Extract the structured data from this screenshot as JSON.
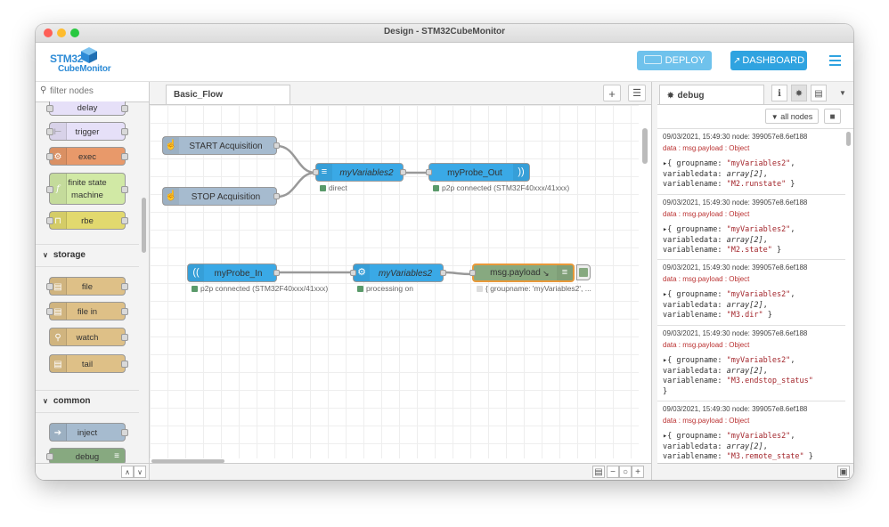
{
  "window": {
    "title": "Design - STM32CubeMonitor"
  },
  "header": {
    "logo_line1": "STM32",
    "logo_line2": "CubeMonitor",
    "deploy_label": "DEPLOY",
    "dashboard_label": "DASHBOARD"
  },
  "palette": {
    "filter_placeholder": "filter nodes",
    "nodes_top": [
      {
        "label": "delay"
      },
      {
        "label": "trigger"
      },
      {
        "label": "exec"
      },
      {
        "label_line1": "finite state",
        "label_line2": "machine"
      },
      {
        "label": "rbe"
      }
    ],
    "category_storage": "storage",
    "nodes_storage": [
      {
        "label": "file"
      },
      {
        "label": "file in"
      },
      {
        "label": "watch"
      },
      {
        "label": "tail"
      }
    ],
    "category_common": "common",
    "nodes_common": [
      {
        "label": "inject"
      },
      {
        "label": "debug"
      }
    ]
  },
  "workspace": {
    "tab_label": "Basic_Flow",
    "nodes": {
      "start": "START Acquisition",
      "stop": "STOP Acquisition",
      "var1": "myVariables2",
      "probe_out": "myProbe_Out",
      "probe_in": "myProbe_In",
      "var2": "myVariables2",
      "debug": "msg.payload"
    },
    "status": {
      "var1": "direct",
      "probe_out": "p2p connected (STM32F40xxx/41xxx)",
      "probe_in": "p2p connected (STM32F40xxx/41xxx)",
      "var2": "processing on",
      "debug": "{ groupname: 'myVariables2', ..."
    }
  },
  "sidebar": {
    "tab_label": "debug",
    "filter_label": "all nodes",
    "messages": [
      {
        "meta": "09/03/2021, 15:49:30   node: 399057e8.6ef188",
        "topic": "data : msg.payload : Object",
        "groupname": "\"myVariables2\"",
        "variabledata": "array[2]",
        "variablename": "\"M2.runstate\""
      },
      {
        "meta": "09/03/2021, 15:49:30   node: 399057e8.6ef188",
        "topic": "data : msg.payload : Object",
        "groupname": "\"myVariables2\"",
        "variabledata": "array[2]",
        "variablename": "\"M2.state\""
      },
      {
        "meta": "09/03/2021, 15:49:30   node: 399057e8.6ef188",
        "topic": "data : msg.payload : Object",
        "groupname": "\"myVariables2\"",
        "variabledata": "array[2]",
        "variablename": "\"M3.dir\""
      },
      {
        "meta": "09/03/2021, 15:49:30   node: 399057e8.6ef188",
        "topic": "data : msg.payload : Object",
        "groupname": "\"myVariables2\"",
        "variabledata": "array[2]",
        "variablename": "\"M3.endstop_status\""
      },
      {
        "meta": "09/03/2021, 15:49:30   node: 399057e8.6ef188",
        "topic": "data : msg.payload : Object",
        "groupname": "\"myVariables2\"",
        "variabledata": "array[2]",
        "variablename": "\"M3.remote_state\""
      }
    ]
  },
  "colors": {
    "accent": "#2fa3e0",
    "inject": "#a6bbcf",
    "probe": "#3aa9e6",
    "function": "#e2d96e",
    "exec": "#e8996a",
    "fsm": "#d1e9a5",
    "debug": "#87a980"
  }
}
